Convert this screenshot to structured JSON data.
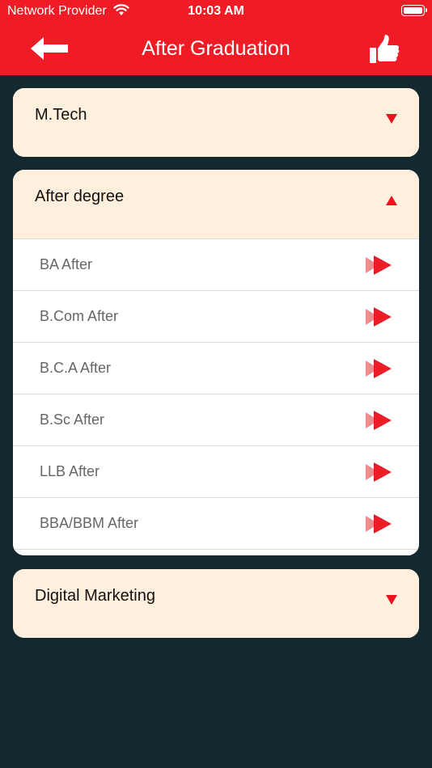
{
  "status_bar": {
    "carrier": "Network Provider",
    "time": "10:03 AM"
  },
  "header": {
    "title": "After Graduation"
  },
  "colors": {
    "header_bg": "#ef1c25",
    "page_bg": "#142830",
    "card_header_bg": "#fff0dd",
    "accent_red": "#e8141e"
  },
  "sections": [
    {
      "title": "M.Tech",
      "expanded": false
    },
    {
      "title": "After degree",
      "expanded": true,
      "items": [
        "BA After",
        "B.Com After",
        "B.C.A After",
        "B.Sc After",
        "LLB After",
        "BBA/BBM After"
      ]
    },
    {
      "title": "Digital Marketing",
      "expanded": false
    }
  ]
}
